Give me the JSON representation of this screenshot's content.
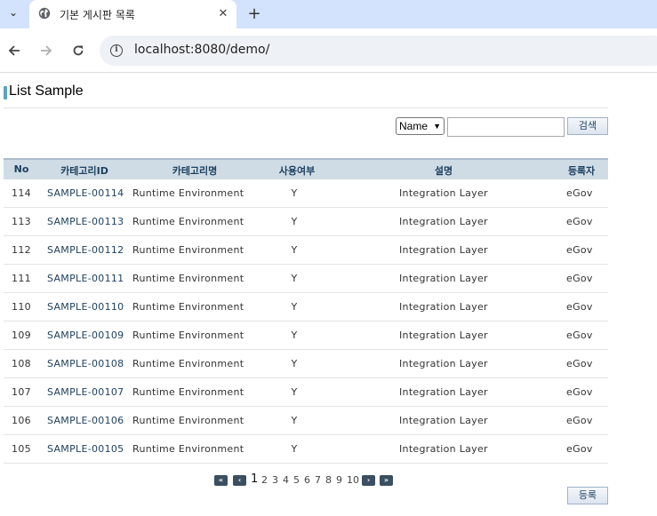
{
  "browser": {
    "tab_title": "기본 게시판 목록",
    "close_glyph": "✕",
    "new_tab_glyph": "+",
    "url": "localhost:8080/demo/"
  },
  "page": {
    "title": "List Sample"
  },
  "search": {
    "select_value": "Name",
    "input_value": "",
    "button_label": "검색"
  },
  "table": {
    "headers": [
      "No",
      "카테고리ID",
      "카테고리명",
      "사용여부",
      "설명",
      "등록자"
    ],
    "rows": [
      {
        "no": "114",
        "id": "SAMPLE-00114",
        "name": "Runtime Environment",
        "use": "Y",
        "desc": "Integration Layer",
        "user": "eGov"
      },
      {
        "no": "113",
        "id": "SAMPLE-00113",
        "name": "Runtime Environment",
        "use": "Y",
        "desc": "Integration Layer",
        "user": "eGov"
      },
      {
        "no": "112",
        "id": "SAMPLE-00112",
        "name": "Runtime Environment",
        "use": "Y",
        "desc": "Integration Layer",
        "user": "eGov"
      },
      {
        "no": "111",
        "id": "SAMPLE-00111",
        "name": "Runtime Environment",
        "use": "Y",
        "desc": "Integration Layer",
        "user": "eGov"
      },
      {
        "no": "110",
        "id": "SAMPLE-00110",
        "name": "Runtime Environment",
        "use": "Y",
        "desc": "Integration Layer",
        "user": "eGov"
      },
      {
        "no": "109",
        "id": "SAMPLE-00109",
        "name": "Runtime Environment",
        "use": "Y",
        "desc": "Integration Layer",
        "user": "eGov"
      },
      {
        "no": "108",
        "id": "SAMPLE-00108",
        "name": "Runtime Environment",
        "use": "Y",
        "desc": "Integration Layer",
        "user": "eGov"
      },
      {
        "no": "107",
        "id": "SAMPLE-00107",
        "name": "Runtime Environment",
        "use": "Y",
        "desc": "Integration Layer",
        "user": "eGov"
      },
      {
        "no": "106",
        "id": "SAMPLE-00106",
        "name": "Runtime Environment",
        "use": "Y",
        "desc": "Integration Layer",
        "user": "eGov"
      },
      {
        "no": "105",
        "id": "SAMPLE-00105",
        "name": "Runtime Environment",
        "use": "Y",
        "desc": "Integration Layer",
        "user": "eGov"
      }
    ]
  },
  "pagination": {
    "first_glyph": "«",
    "prev_glyph": "‹",
    "next_glyph": "›",
    "last_glyph": "»",
    "pages": [
      "1",
      "2",
      "3",
      "4",
      "5",
      "6",
      "7",
      "8",
      "9",
      "10"
    ],
    "current": "1"
  },
  "actions": {
    "register_label": "등록"
  }
}
